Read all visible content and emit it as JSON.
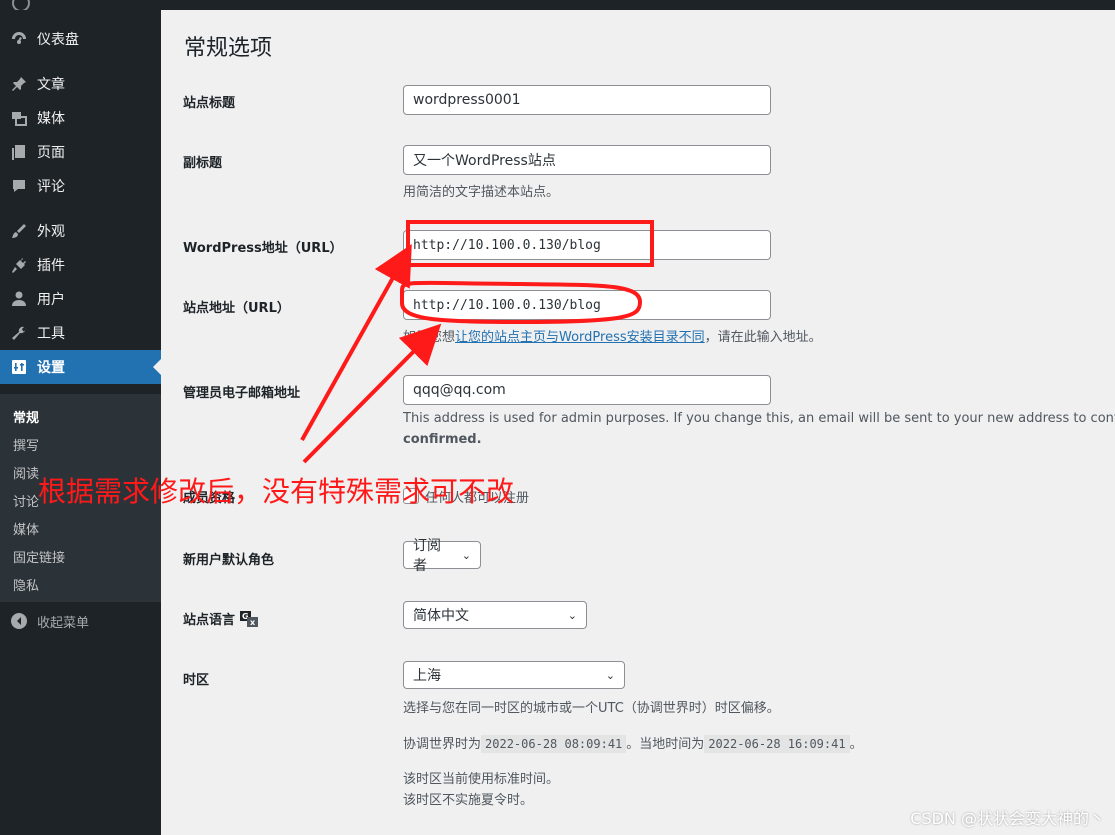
{
  "sidebar": {
    "items": [
      {
        "id": "dashboard",
        "label": "仪表盘",
        "icon": "dashboard-icon"
      },
      {
        "id": "posts",
        "label": "文章",
        "icon": "pin-icon"
      },
      {
        "id": "media",
        "label": "媒体",
        "icon": "media-icon"
      },
      {
        "id": "pages",
        "label": "页面",
        "icon": "page-icon"
      },
      {
        "id": "comments",
        "label": "评论",
        "icon": "comment-icon"
      },
      {
        "id": "appearance",
        "label": "外观",
        "icon": "brush-icon"
      },
      {
        "id": "plugins",
        "label": "插件",
        "icon": "plugin-icon"
      },
      {
        "id": "users",
        "label": "用户",
        "icon": "user-icon"
      },
      {
        "id": "tools",
        "label": "工具",
        "icon": "wrench-icon"
      },
      {
        "id": "settings",
        "label": "设置",
        "icon": "settings-icon"
      }
    ],
    "submenu": [
      "常规",
      "撰写",
      "阅读",
      "讨论",
      "媒体",
      "固定链接",
      "隐私"
    ],
    "collapse": "收起菜单"
  },
  "page": {
    "title": "常规选项"
  },
  "form": {
    "site_title": {
      "label": "站点标题",
      "value": "wordpress0001"
    },
    "tagline": {
      "label": "副标题",
      "value": "又一个WordPress站点",
      "desc": "用简洁的文字描述本站点。"
    },
    "wp_url": {
      "label": "WordPress地址（URL）",
      "value": "http://10.100.0.130/blog"
    },
    "site_url": {
      "label": "站点地址（URL）",
      "value": "http://10.100.0.130/blog",
      "desc_prefix": "如果您想",
      "desc_link": "让您的站点主页与WordPress安装目录不同",
      "desc_suffix": "，请在此输入地址。"
    },
    "admin_email": {
      "label": "管理员电子邮箱地址",
      "value": "qqq@qq.com",
      "desc_line1": "This address is used for admin purposes. If you change this, an email will be sent to your new address to confirm it.",
      "desc_line2": "confirmed."
    },
    "membership": {
      "label": "成员资格",
      "checkbox_label": "任何人都可以注册"
    },
    "default_role": {
      "label": "新用户默认角色",
      "value": "订阅者"
    },
    "language": {
      "label": "站点语言",
      "value": "简体中文"
    },
    "timezone": {
      "label": "时区",
      "value": "上海",
      "desc": "选择与您在同一时区的城市或一个UTC（协调世界时）时区偏移。",
      "utc_prefix": "协调世界时为",
      "utc_time": "2022-06-28 08:09:41",
      "local_prefix": "。当地时间为",
      "local_time": "2022-06-28 16:09:41",
      "local_suffix": "。",
      "note1": "该时区当前使用标准时间。",
      "note2": "该时区不实施夏令时。"
    }
  },
  "annotation": {
    "text": "根据需求修改后，没有特殊需求可不改",
    "color": "#ff1a1a"
  },
  "watermark": "CSDN @状状会变大神的丶"
}
